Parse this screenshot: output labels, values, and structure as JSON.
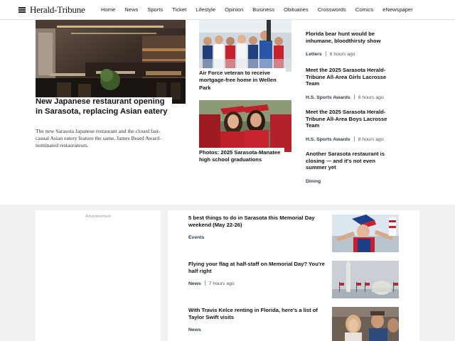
{
  "header": {
    "logo": "Herald-Tribune",
    "nav": [
      "Home",
      "News",
      "Sports",
      "Ticket",
      "Lifestyle",
      "Opinion",
      "Business",
      "Obituaries",
      "Crosswords",
      "Comics",
      "eNewspaper"
    ]
  },
  "lead": {
    "title": "New Japanese restaurant opening in Sarasota, replacing Asian eatery",
    "description": "The new Sarasota Japanese restaurant and the closed fast-casual Asian eatery feature the same, James Beard Award-nominated restaurateurs."
  },
  "middle": [
    {
      "title": "Air Force veteran to receive mortgage-free home in Wellen Park"
    },
    {
      "title": "Photos: 2025 Sarasota-Manatee high school graduations"
    }
  ],
  "right": [
    {
      "title": "Florida bear hunt would be inhumane, bloodthirsty show",
      "tag": "Letters",
      "time": "6 hours ago"
    },
    {
      "title": "Meet the 2025 Sarasota Herald-Tribune All-Area Girls Lacrosse Team",
      "tag": "H.S. Sports Awards",
      "time": "8 hours ago"
    },
    {
      "title": "Meet the 2025 Sarasota Herald-Tribune All-Area Boys Lacrosse Team",
      "tag": "H.S. Sports Awards",
      "time": "8 hours ago"
    },
    {
      "title": "Another Sarasota restaurant is closing — and it's not even summer yet",
      "tag": "Dining",
      "time": ""
    }
  ],
  "ad": {
    "label": "Advertisement"
  },
  "list": [
    {
      "title": "5 best things to do in Sarasota this Memorial Day weekend (May 22-26)",
      "tag": "Events",
      "time": ""
    },
    {
      "title": "Flying your flag at half-staff on Memorial Day? You're half right",
      "tag": "News",
      "time": "7 hours ago"
    },
    {
      "title": "With Travis Kelce renting in Florida, here's a list of Taylor Swift visits",
      "tag": "News",
      "time": ""
    }
  ],
  "colors": {
    "tag_text": "#2b3a4a",
    "lower_bg": "#f1f1f1",
    "grad_gown": "#c0202a"
  }
}
